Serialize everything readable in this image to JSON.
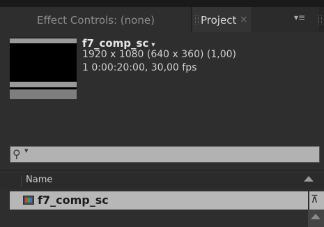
{
  "tabs": {
    "effect_controls": "Effect Controls: (none)",
    "project": "Project",
    "project_close": "×",
    "menu": "▾≡"
  },
  "item_info": {
    "name": "f7_comp_sc",
    "dropdown": "▾",
    "line1": "1920 x 1080  (640 x 360) (1,00)",
    "line2": "1 0:00:20:00, 30,00 fps"
  },
  "search": {
    "glass": "⚲",
    "drop": "▾",
    "value": ""
  },
  "columns": {
    "name": "Name"
  },
  "items": [
    {
      "name": "f7_comp_sc"
    }
  ],
  "icons": {
    "flowchart": "flowchart-icon",
    "composition": "composition-icon"
  }
}
